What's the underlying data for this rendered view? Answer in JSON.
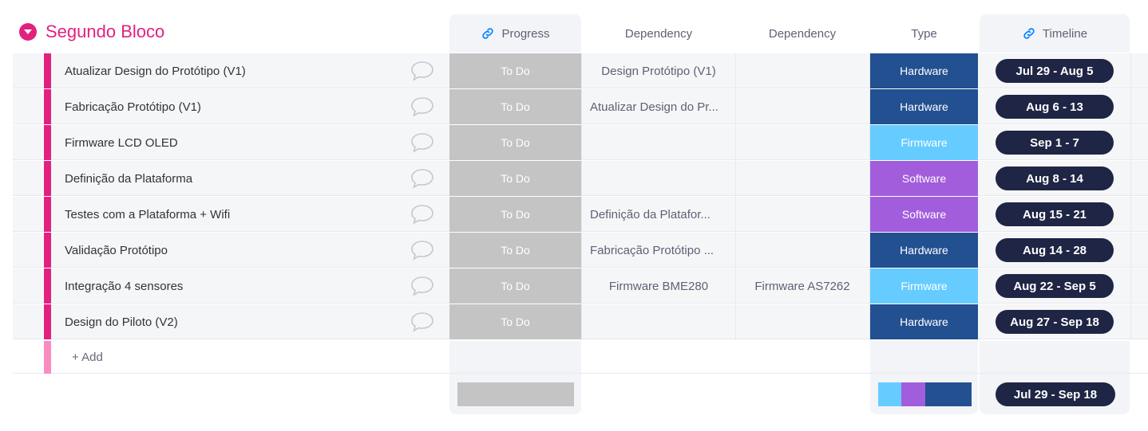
{
  "group": {
    "title": "Segundo Bloco"
  },
  "columns": {
    "progress": "Progress",
    "dependency1": "Dependency",
    "dependency2": "Dependency",
    "type": "Type",
    "timeline": "Timeline"
  },
  "colors": {
    "group": "#e2217f",
    "progress": "#c4c4c4",
    "hardware": "#225091",
    "firmware": "#66ccff",
    "software": "#a25ddc",
    "pill": "#1f2544"
  },
  "rows": [
    {
      "name": "Atualizar Design do Protótipo (V1)",
      "progress": "To Do",
      "dependency1": "Design Protótipo (V1)",
      "dependency2": "",
      "type": "Hardware",
      "timeline": "Jul 29 - Aug 5"
    },
    {
      "name": "Fabricação Protótipo (V1)",
      "progress": "To Do",
      "dependency1": "Atualizar Design do Pr...",
      "dependency2": "",
      "type": "Hardware",
      "timeline": "Aug 6 - 13"
    },
    {
      "name": "Firmware LCD OLED",
      "progress": "To Do",
      "dependency1": "",
      "dependency2": "",
      "type": "Firmware",
      "timeline": "Sep 1 - 7"
    },
    {
      "name": "Definição da Plataforma",
      "progress": "To Do",
      "dependency1": "",
      "dependency2": "",
      "type": "Software",
      "timeline": "Aug 8 - 14"
    },
    {
      "name": "Testes com a Plataforma + Wifi",
      "progress": "To Do",
      "dependency1": "Definição da Platafor...",
      "dependency2": "",
      "type": "Software",
      "timeline": "Aug 15 - 21"
    },
    {
      "name": "Validação Protótipo",
      "progress": "To Do",
      "dependency1": "Fabricação Protótipo ...",
      "dependency2": "",
      "type": "Hardware",
      "timeline": "Aug 14 - 28"
    },
    {
      "name": "Integração 4 sensores",
      "progress": "To Do",
      "dependency1": "Firmware BME280",
      "dependency2": "Firmware AS7262",
      "type": "Firmware",
      "timeline": "Aug 22 - Sep 5"
    },
    {
      "name": "Design do Piloto (V2)",
      "progress": "To Do",
      "dependency1": "",
      "dependency2": "",
      "type": "Hardware",
      "timeline": "Aug 27 - Sep 18"
    }
  ],
  "add_row": {
    "label": "+ Add"
  },
  "footer": {
    "timeline": "Jul 29 - Sep 18",
    "type_distribution": [
      {
        "type": "Firmware",
        "fraction": 0.25
      },
      {
        "type": "Software",
        "fraction": 0.25
      },
      {
        "type": "Hardware",
        "fraction": 0.5
      }
    ]
  }
}
